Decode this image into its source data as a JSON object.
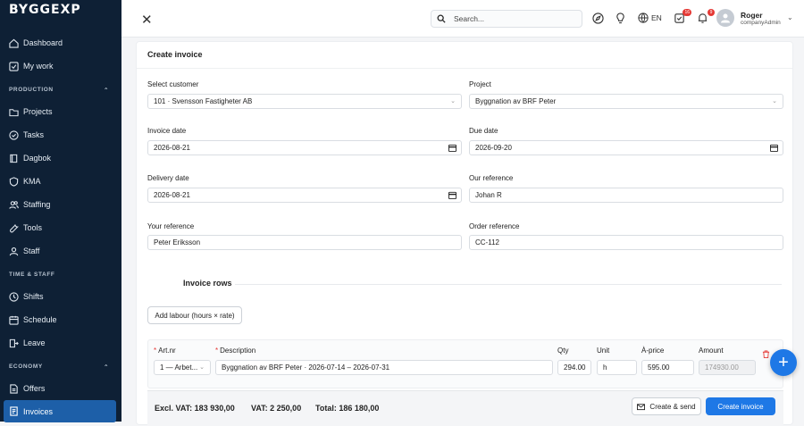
{
  "brand": {
    "logo": "BYGGEXP"
  },
  "sidebar": {
    "items": [
      {
        "label": "Dashboard",
        "icon": "dashboard-icon"
      },
      {
        "label": "My work",
        "icon": "checkbox-icon"
      }
    ],
    "sections": [
      {
        "title": "PRODUCTION",
        "items": [
          {
            "label": "Projects",
            "icon": "folder-icon"
          },
          {
            "label": "Tasks",
            "icon": "check-circle-icon"
          },
          {
            "label": "Dagbok",
            "icon": "book-icon"
          },
          {
            "label": "KMA",
            "icon": "shield-icon"
          },
          {
            "label": "Staffing",
            "icon": "users-icon"
          },
          {
            "label": "Tools",
            "icon": "wrench-icon"
          },
          {
            "label": "Staff",
            "icon": "user-icon"
          }
        ]
      },
      {
        "title": "TIME & STAFF",
        "items": [
          {
            "label": "Shifts",
            "icon": "clock-icon"
          },
          {
            "label": "Schedule",
            "icon": "calendar-icon"
          },
          {
            "label": "Leave",
            "icon": "leave-icon"
          }
        ]
      },
      {
        "title": "ECONOMY",
        "items": [
          {
            "label": "Offers",
            "icon": "document-icon"
          },
          {
            "label": "Invoices",
            "icon": "invoice-icon"
          }
        ]
      }
    ]
  },
  "topbar": {
    "search_placeholder": "Search...",
    "language": "EN",
    "tasks_badge": "16",
    "notifications_badge": "9",
    "user_name": "Roger",
    "user_role": "companyAdmin"
  },
  "form": {
    "title": "Create invoice",
    "customer_label": "Select customer",
    "customer_value": "101 · Svensson Fastigheter AB",
    "project_label": "Project",
    "project_value": "Byggnation av BRF Peter",
    "invoice_date_label": "Invoice date",
    "invoice_date_value": "2026-08-21",
    "due_date_label": "Due date",
    "due_date_value": "2026-09-20",
    "delivery_date_label": "Delivery date",
    "delivery_date_value": "2026-08-21",
    "our_ref_label": "Our reference",
    "our_ref_value": "Johan R",
    "your_ref_label": "Your reference",
    "your_ref_value": "Peter Eriksson",
    "order_ref_label": "Order reference",
    "order_ref_value": "CC-112"
  },
  "rows": {
    "section_title": "Invoice rows",
    "add_labour": "Add labour (hours × rate)",
    "headers": {
      "art": "Art.nr",
      "desc": "Description",
      "qty": "Qty",
      "unit": "Unit",
      "price": "À-price",
      "amount": "Amount"
    },
    "row": {
      "art": "1 — Arbet...",
      "desc": "Byggnation av BRF Peter · 2026-07-14 – 2026-07-31",
      "qty": "294.00",
      "unit": "h",
      "price": "595.00",
      "amount": "174930.00"
    }
  },
  "totals": {
    "excl": "Excl. VAT: 183 930,00",
    "vat": "VAT: 2 250,00",
    "total": "Total: 186 180,00",
    "create_send": "Create & send",
    "create": "Create invoice"
  },
  "colors": {
    "sidebar": "#0e2035",
    "accent": "#1e78e6",
    "active": "#1d5fa8",
    "danger": "#e53935"
  }
}
